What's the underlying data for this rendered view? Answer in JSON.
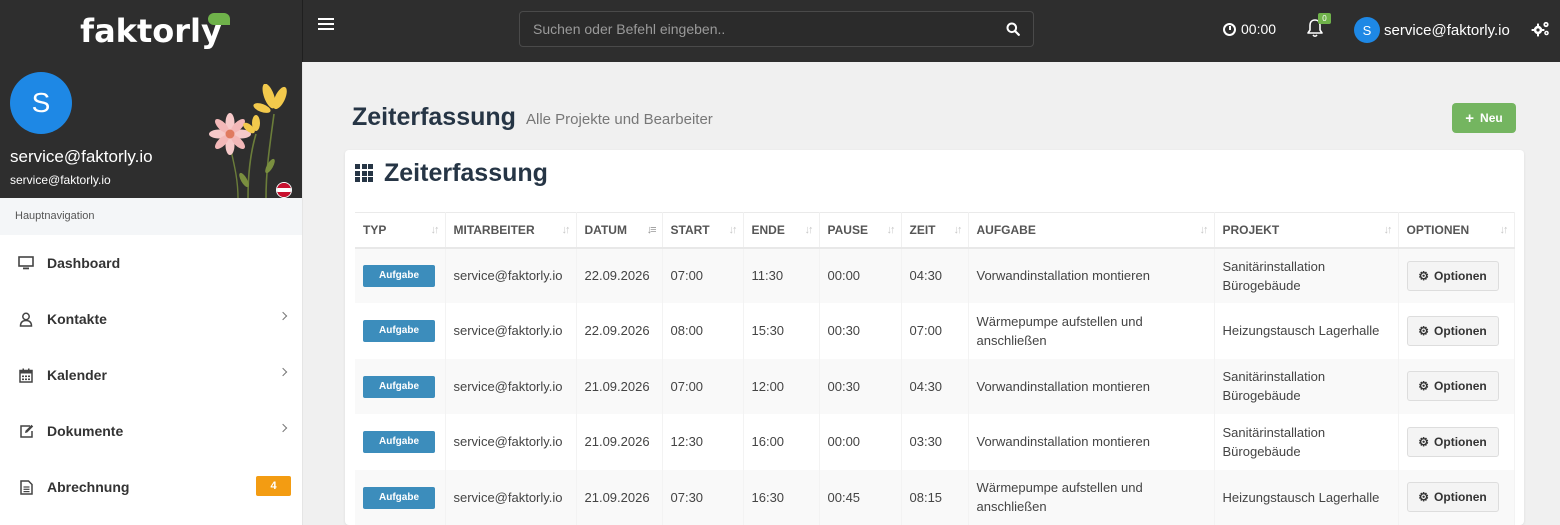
{
  "brand": {
    "name": "faktorly"
  },
  "search": {
    "placeholder": "Suchen oder Befehl eingeben.."
  },
  "timer": {
    "value": "00:00"
  },
  "notifications": {
    "count": "0"
  },
  "user": {
    "initial": "S",
    "email": "service@faktorly.io"
  },
  "profile": {
    "initial": "S",
    "name": "service@faktorly.io",
    "email": "service@faktorly.io"
  },
  "sidebar": {
    "header": "Hauptnavigation",
    "items": [
      {
        "label": "Dashboard",
        "icon": "monitor-icon"
      },
      {
        "label": "Kontakte",
        "icon": "user-icon"
      },
      {
        "label": "Kalender",
        "icon": "calendar-icon"
      },
      {
        "label": "Dokumente",
        "icon": "edit-icon"
      },
      {
        "label": "Abrechnung",
        "icon": "file-icon",
        "badge": "4"
      }
    ]
  },
  "page": {
    "title": "Zeiterfassung",
    "subtitle": "Alle Projekte und Bearbeiter",
    "new_label": "Neu"
  },
  "card": {
    "title": "Zeiterfassung"
  },
  "table": {
    "headers": [
      "TYP",
      "MITARBEITER",
      "DATUM",
      "START",
      "ENDE",
      "PAUSE",
      "ZEIT",
      "AUFGABE",
      "PROJEKT",
      "OPTIONEN"
    ],
    "rows": [
      {
        "typ": "Aufgabe",
        "mitarbeiter": "service@faktorly.io",
        "datum": "22.09.2026",
        "start": "07:00",
        "ende": "11:30",
        "pause": "00:00",
        "zeit": "04:30",
        "aufgabe": "Vorwandinstallation montieren",
        "projekt": "Sanitärinstallation Bürogebäude",
        "optionen": "Optionen"
      },
      {
        "typ": "Aufgabe",
        "mitarbeiter": "service@faktorly.io",
        "datum": "22.09.2026",
        "start": "08:00",
        "ende": "15:30",
        "pause": "00:30",
        "zeit": "07:00",
        "aufgabe": "Wärmepumpe aufstellen und anschließen",
        "projekt": "Heizungstausch Lagerhalle",
        "optionen": "Optionen"
      },
      {
        "typ": "Aufgabe",
        "mitarbeiter": "service@faktorly.io",
        "datum": "21.09.2026",
        "start": "07:00",
        "ende": "12:00",
        "pause": "00:30",
        "zeit": "04:30",
        "aufgabe": "Vorwandinstallation montieren",
        "projekt": "Sanitärinstallation Bürogebäude",
        "optionen": "Optionen"
      },
      {
        "typ": "Aufgabe",
        "mitarbeiter": "service@faktorly.io",
        "datum": "21.09.2026",
        "start": "12:30",
        "ende": "16:00",
        "pause": "00:00",
        "zeit": "03:30",
        "aufgabe": "Vorwandinstallation montieren",
        "projekt": "Sanitärinstallation Bürogebäude",
        "optionen": "Optionen"
      },
      {
        "typ": "Aufgabe",
        "mitarbeiter": "service@faktorly.io",
        "datum": "21.09.2026",
        "start": "07:30",
        "ende": "16:30",
        "pause": "00:45",
        "zeit": "08:15",
        "aufgabe": "Wärmepumpe aufstellen und anschließen",
        "projekt": "Heizungstausch Lagerhalle",
        "optionen": "Optionen"
      }
    ]
  },
  "colors": {
    "topbar": "#2e2e2e",
    "accent_green": "#74b560",
    "task_badge": "#3c8dbc",
    "avatar_blue": "#1e88e5",
    "warning_badge": "#f39c12"
  }
}
